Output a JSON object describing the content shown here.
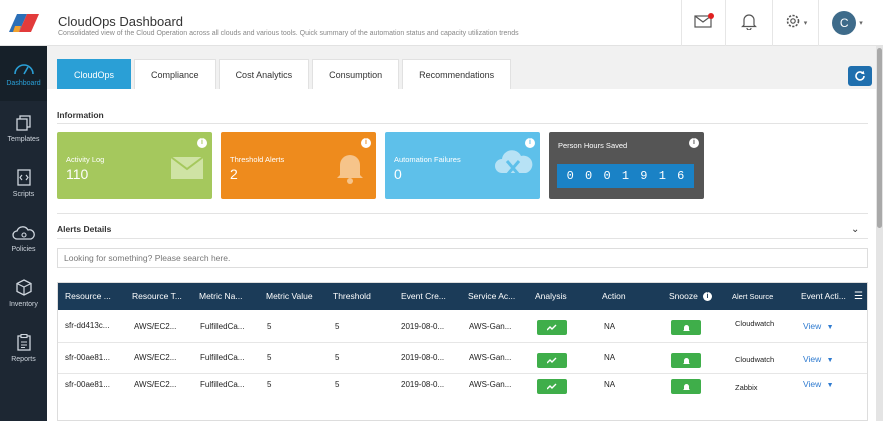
{
  "header": {
    "title": "CloudOps Dashboard",
    "subtitle": "Consolidated view of the Cloud Operation across all clouds and various tools. Quick summary of the automation status and capacity utilization trends",
    "avatar_initial": "C"
  },
  "sidebar": {
    "items": [
      {
        "label": "Dashboard",
        "icon": "speedometer-icon"
      },
      {
        "label": "Templates",
        "icon": "template-icon"
      },
      {
        "label": "Scripts",
        "icon": "script-icon"
      },
      {
        "label": "Policies",
        "icon": "cloud-cog-icon"
      },
      {
        "label": "Inventory",
        "icon": "cube-icon"
      },
      {
        "label": "Reports",
        "icon": "report-icon"
      }
    ]
  },
  "tabs": [
    "CloudOps",
    "Compliance",
    "Cost Analytics",
    "Consumption",
    "Recommendations"
  ],
  "information": {
    "title": "Information",
    "cards": [
      {
        "label": "Activity Log",
        "value": "110",
        "color": "#a5c85d"
      },
      {
        "label": "Threshold Alerts",
        "value": "2",
        "color": "#ee8b1d"
      },
      {
        "label": "Automation Failures",
        "value": "0",
        "color": "#5ec0ea"
      },
      {
        "label": "Person Hours Saved",
        "digits": [
          "0",
          "0",
          "0",
          "1",
          "9",
          "1",
          "6"
        ],
        "color": "#555555"
      }
    ]
  },
  "alerts": {
    "title": "Alerts Details",
    "search_placeholder": "Looking for something? Please search here.",
    "columns": [
      "Resource ...",
      "Resource T...",
      "Metric Na...",
      "Metric Value",
      "Threshold",
      "Event Cre...",
      "Service Ac...",
      "Analysis",
      "Action",
      "Snooze",
      "Alert Source",
      "Event Acti..."
    ],
    "rows": [
      {
        "resource": "sfr-dd413c...",
        "type": "AWS/EC2...",
        "metric": "FulfilledCa...",
        "value": "5",
        "threshold": "5",
        "created": "2019-08-0...",
        "service": "AWS-Gan...",
        "action": "NA",
        "source": "Cloudwatch",
        "event_action": "View"
      },
      {
        "resource": "sfr-00ae81...",
        "type": "AWS/EC2...",
        "metric": "FulfilledCa...",
        "value": "5",
        "threshold": "5",
        "created": "2019-08-0...",
        "service": "AWS-Gan...",
        "action": "NA",
        "source": "Cloudwatch",
        "event_action": "View"
      },
      {
        "resource": "sfr-00ae81...",
        "type": "AWS/EC2...",
        "metric": "FulfilledCa...",
        "value": "5",
        "threshold": "5",
        "created": "2019-08-0...",
        "service": "AWS-Gan...",
        "action": "NA",
        "source": "Zabbix",
        "event_action": "View"
      }
    ]
  },
  "colors": {
    "primary": "#2a9fd6",
    "sidebar": "#1d2733",
    "table_header": "#1b3b58",
    "success": "#3fae4a"
  }
}
